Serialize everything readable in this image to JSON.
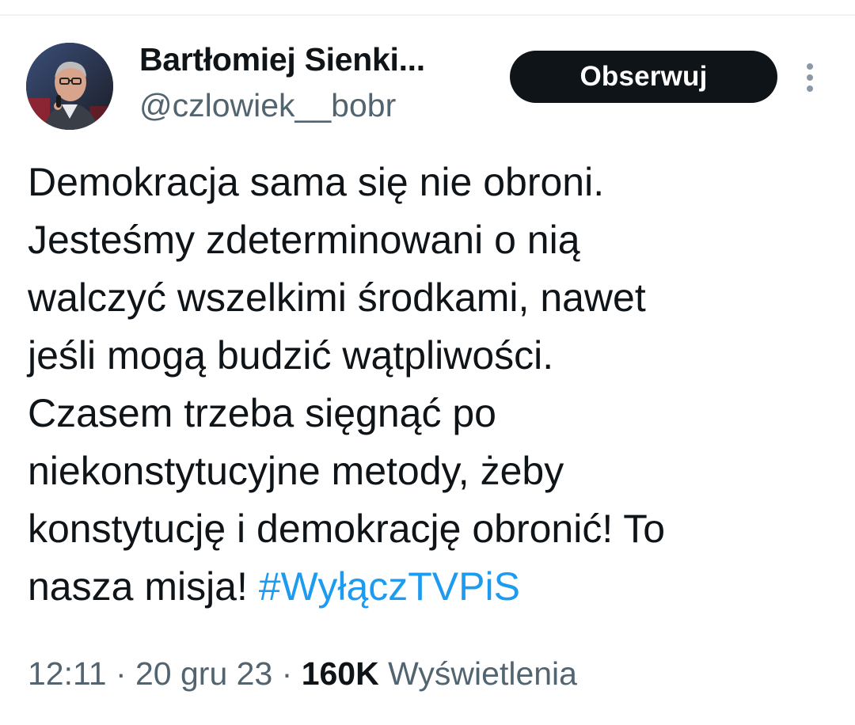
{
  "author": {
    "display_name": "Bartłomiej Sienki...",
    "handle": "@czlowiek__bobr"
  },
  "follow_button": {
    "label": "Obserwuj"
  },
  "more_icon": "more-vertical-icon",
  "tweet": {
    "lines": [
      "Demokracja sama się nie obroni.",
      "Jesteśmy zdeterminowani o nią",
      "walczyć wszelkimi środkami, nawet",
      "jeśli mogą budzić wątpliwości.",
      "Czasem trzeba sięgnąć po",
      "niekonstytucyjne metody, żeby",
      "konstytucję i demokrację obronić! To",
      "nasza misja! "
    ],
    "hashtag": "#WyłączTVPiS"
  },
  "meta": {
    "time": "12:11",
    "separator": " · ",
    "date": "20 gru 23",
    "views_count": "160K",
    "views_label": " Wyświetlenia"
  },
  "colors": {
    "link": "#1d9bf0",
    "secondary_text": "#536471",
    "button_bg": "#0f1419"
  }
}
